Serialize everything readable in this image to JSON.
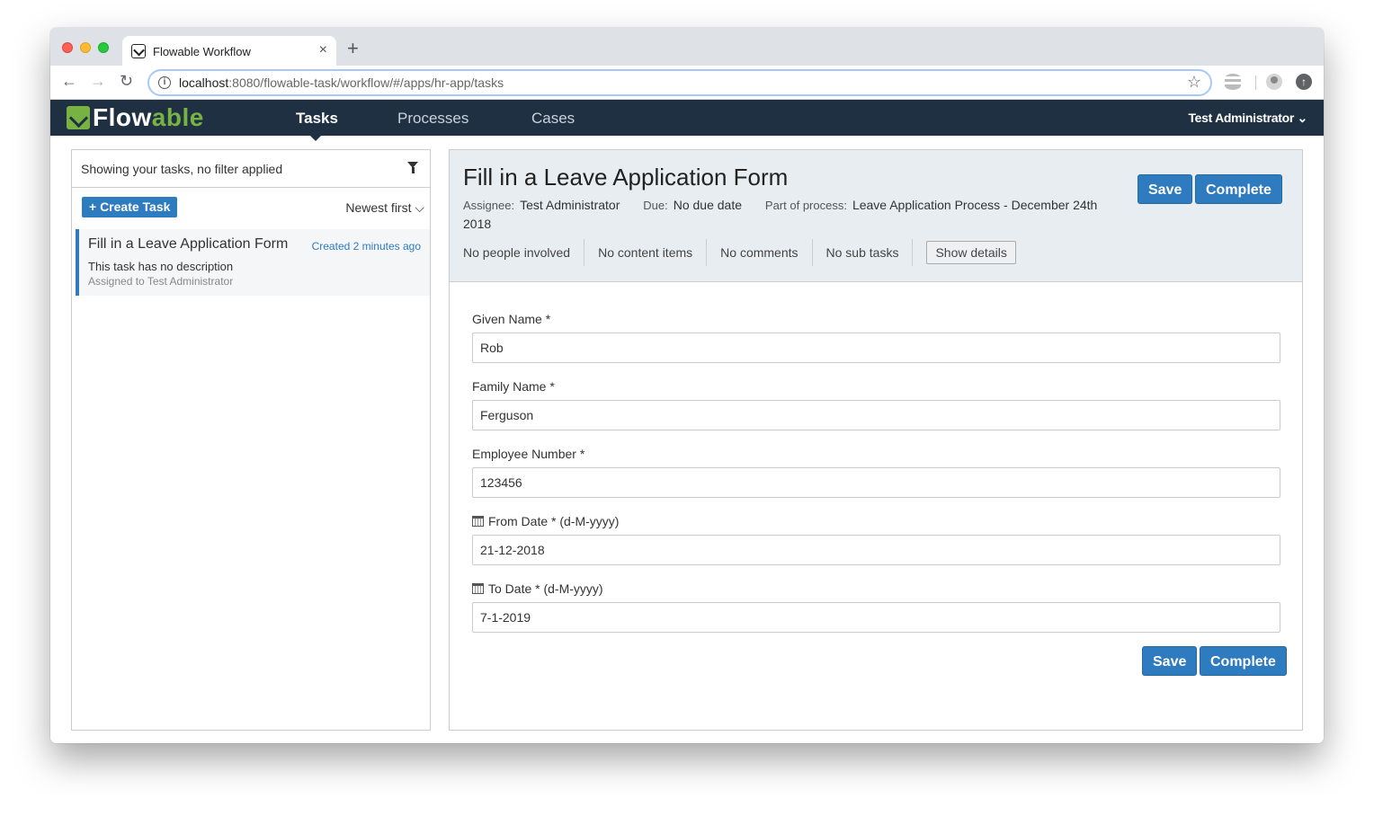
{
  "browser": {
    "tab_title": "Flowable Workflow",
    "tab_close": "×",
    "new_tab": "+",
    "url_host": "localhost",
    "url_rest": ":8080/flowable-task/workflow/#/apps/hr-app/tasks"
  },
  "app": {
    "logo_prefix": "F",
    "logo_main": "low",
    "logo_accent": "able",
    "nav": [
      "Tasks",
      "Processes",
      "Cases"
    ],
    "active_nav": "Tasks",
    "user": "Test Administrator ⌄"
  },
  "task_list": {
    "filter_text": "Showing your tasks, no filter applied",
    "create_button": "+ Create Task",
    "sort": "Newest first ⌵",
    "items": [
      {
        "title": "Fill in a Leave Application Form",
        "created": "Created 2 minutes ago",
        "description": "This task has no description",
        "assigned": "Assigned to Test Administrator"
      }
    ]
  },
  "task_detail": {
    "title": "Fill in a Leave Application Form",
    "assignee_label": "Assignee:",
    "assignee": "Test Administrator",
    "due_label": "Due:",
    "due": "No due date",
    "process_label": "Part of process:",
    "process": "Leave Application Process - December 24th 2018",
    "save": "Save",
    "complete": "Complete",
    "counts": [
      "No people involved",
      "No content items",
      "No comments",
      "No sub tasks"
    ],
    "show_details": "Show details"
  },
  "form": {
    "fields": [
      {
        "label": "Given Name *",
        "value": "Rob"
      },
      {
        "label": "Family Name *",
        "value": "Ferguson"
      },
      {
        "label": "Employee Number *",
        "value": "123456"
      },
      {
        "label": "From Date * (d-M-yyyy)",
        "value": "21-12-2018"
      },
      {
        "label": "To Date * (d-M-yyyy)",
        "value": "7-1-2019"
      }
    ],
    "save": "Save",
    "complete": "Complete"
  },
  "colors": {
    "navbar": "#1f3043",
    "accent": "#2e7bbf",
    "brand_green": "#77b243",
    "header_bg": "#e8edf1"
  }
}
